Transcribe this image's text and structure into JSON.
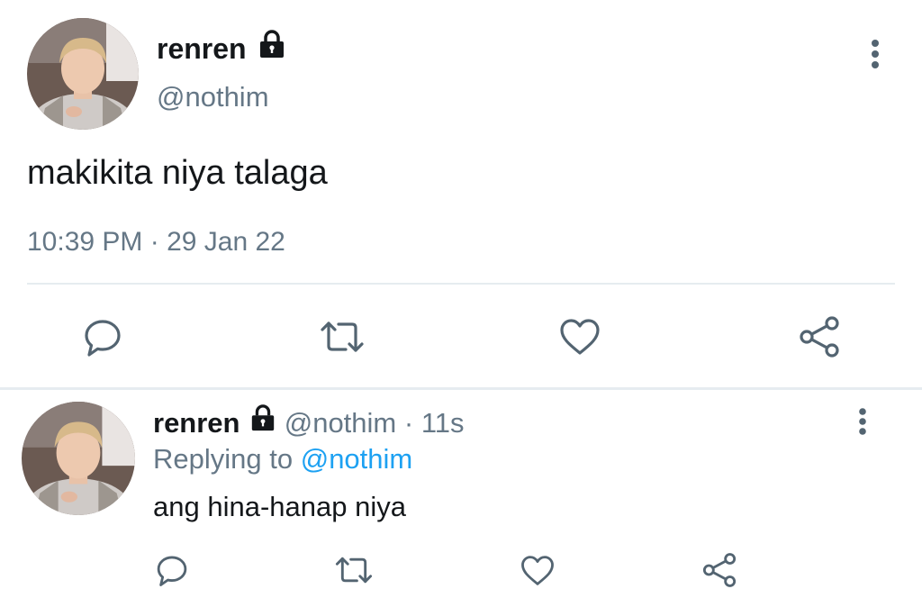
{
  "main_tweet": {
    "display_name": "renren",
    "handle": "@nothim",
    "text": "makikita niya talaga",
    "timestamp": "10:39 PM · 29 Jan 22",
    "actions": [
      "reply-icon",
      "retweet-icon",
      "like-icon",
      "share-icon"
    ]
  },
  "reply_tweet": {
    "display_name": "renren",
    "handle": "@nothim",
    "separator": "·",
    "age": "11s",
    "replying_prefix": "Replying to",
    "replying_handle": "@nothim",
    "text": "ang hina-hanap niya",
    "actions": [
      "reply-icon",
      "retweet-icon",
      "like-icon",
      "share-icon"
    ]
  },
  "colors": {
    "muted": "#657786",
    "link": "#1da1f2",
    "icon": "#536471",
    "divider": "#e6ecf0"
  }
}
